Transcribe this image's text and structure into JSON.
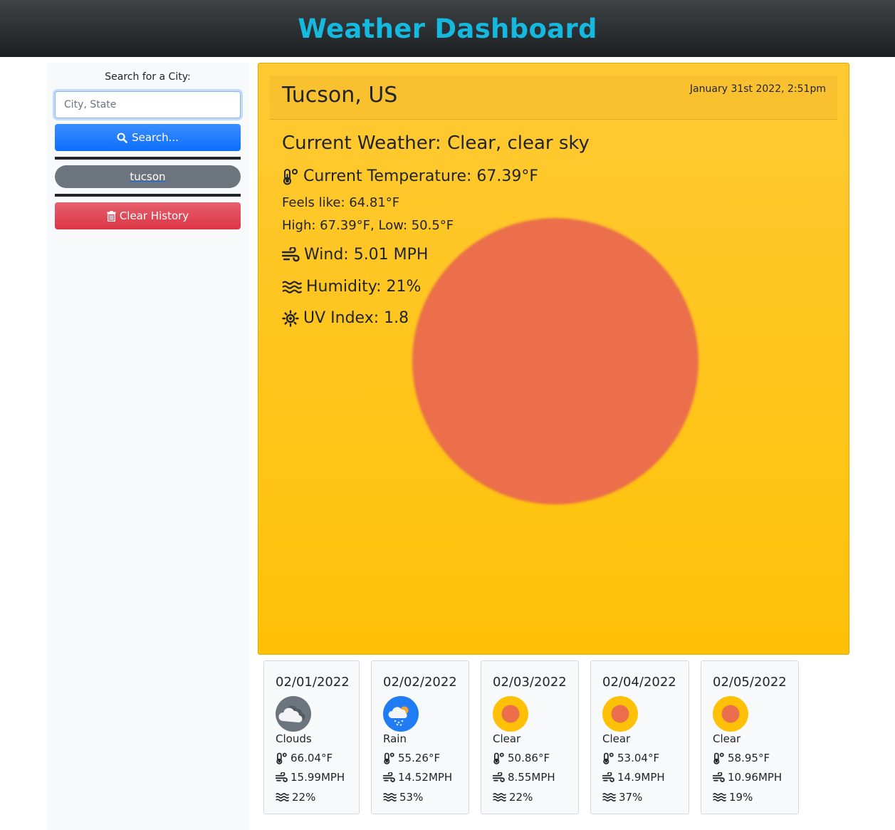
{
  "header": {
    "title": "Weather Dashboard"
  },
  "sidebar": {
    "search_label": "Search for a City:",
    "search_placeholder": "City, State",
    "search_button": "Search...",
    "history": [
      "tucson"
    ],
    "clear_button": "Clear History"
  },
  "current": {
    "city": "Tucson, US",
    "datetime": "January 31st 2022, 2:51pm",
    "weather": "Current Weather: Clear, clear sky",
    "temperature": "Current Temperature: 67.39°F",
    "feels_like": "Feels like: 64.81°F",
    "high_low": "High: 67.39°F, Low: 50.5°F",
    "wind": "Wind: 5.01 MPH",
    "humidity": "Humidity: 21%",
    "uv": "UV Index: 1.8",
    "icon": "clear-sun-icon"
  },
  "forecast": [
    {
      "date": "02/01/2022",
      "desc": "Clouds",
      "temp": "66.04°F",
      "wind": "15.99MPH",
      "humidity": "22%",
      "icon": "clouds-icon"
    },
    {
      "date": "02/02/2022",
      "desc": "Rain",
      "temp": "55.26°F",
      "wind": "14.52MPH",
      "humidity": "53%",
      "icon": "rain-icon"
    },
    {
      "date": "02/03/2022",
      "desc": "Clear",
      "temp": "50.86°F",
      "wind": "8.55MPH",
      "humidity": "22%",
      "icon": "clear-icon"
    },
    {
      "date": "02/04/2022",
      "desc": "Clear",
      "temp": "53.04°F",
      "wind": "14.9MPH",
      "humidity": "37%",
      "icon": "clear-icon"
    },
    {
      "date": "02/05/2022",
      "desc": "Clear",
      "temp": "58.95°F",
      "wind": "10.96MPH",
      "humidity": "19%",
      "icon": "clear-icon"
    }
  ],
  "colors": {
    "title": "#15b8de",
    "card": "#ffc107",
    "sun": "#ea6f4a",
    "primary": "#0d6efd",
    "danger": "#dc3545",
    "secondary": "#6c757d"
  }
}
